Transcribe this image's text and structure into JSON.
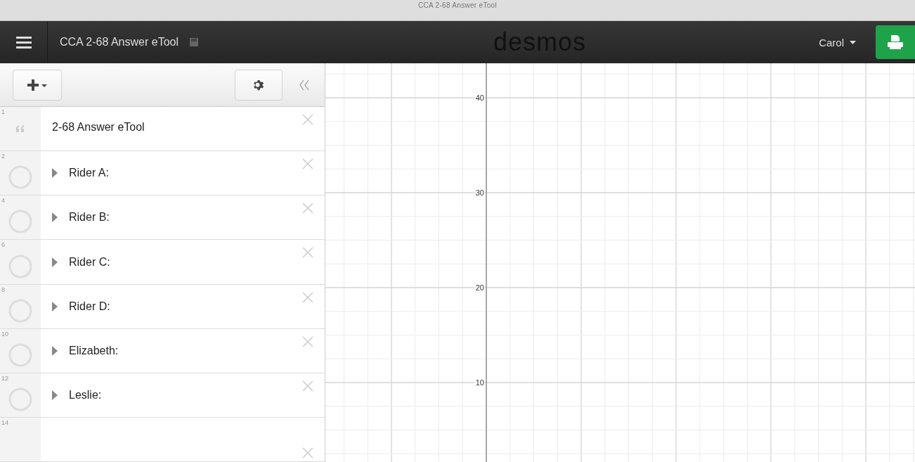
{
  "browser_tab": {
    "title": "CCA 2-68 Answer eTool"
  },
  "header": {
    "title": "CCA 2-68 Answer eTool",
    "logo": "desmos",
    "user": "Carol"
  },
  "expressions": [
    {
      "kind": "note",
      "number": "1",
      "text": "2-68 Answer eTool"
    },
    {
      "kind": "folder",
      "number": "2",
      "text": "Rider A:",
      "expanded": false
    },
    {
      "kind": "folder",
      "number": "4",
      "text": "Rider B:",
      "expanded": false
    },
    {
      "kind": "folder",
      "number": "6",
      "text": "Rider C:",
      "expanded": false
    },
    {
      "kind": "folder",
      "number": "8",
      "text": "Rider D:",
      "expanded": false
    },
    {
      "kind": "folder",
      "number": "10",
      "text": "Elizabeth:",
      "expanded": false
    },
    {
      "kind": "folder",
      "number": "12",
      "text": "Leslie:",
      "expanded": false
    },
    {
      "kind": "empty",
      "number": "14"
    }
  ],
  "graph": {
    "y_labels": [
      "40",
      "30",
      "20",
      "10"
    ]
  }
}
